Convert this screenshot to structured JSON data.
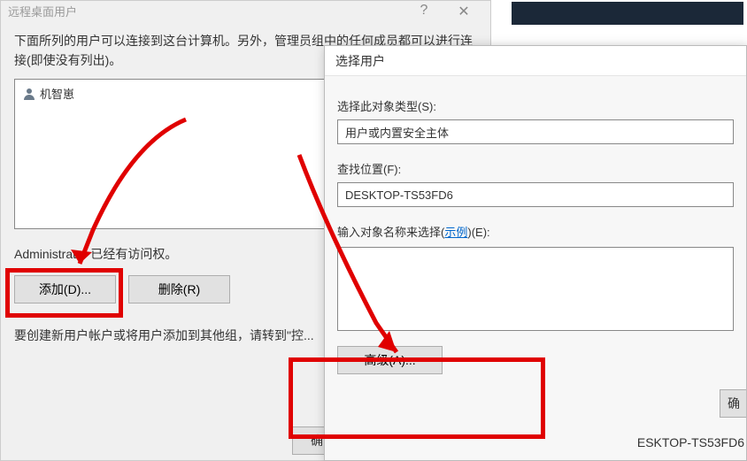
{
  "left_dialog": {
    "title": "远程桌面用户",
    "description": "下面所列的用户可以连接到这台计算机。另外，管理员组中的任何成员都可以进行连接(即使没有列出)。",
    "users": [
      {
        "name": "机智崽"
      }
    ],
    "admin_note": "Administrator 已经有访问权。",
    "add_button": "添加(D)...",
    "remove_button": "删除(R)",
    "create_note": "要创建新用户帐户或将用户添加到其他组，请转到\"控...",
    "ok_button": "确"
  },
  "right_dialog": {
    "title": "选择用户",
    "object_type_label": "选择此对象类型(S):",
    "object_type": "用户或内置安全主体",
    "location_label": "查找位置(F):",
    "location": "DESKTOP-TS53FD6",
    "names_label_prefix": "输入对象名称来选择(",
    "names_label_link": "示例",
    "names_label_suffix": ")(E):",
    "names_value": "",
    "advanced_button": "高级(A)...",
    "ok_right_text": "确",
    "hostname_tail": "ESKTOP-TS53FD6"
  },
  "colors": {
    "accent_red": "#e00000",
    "link": "#0066cc"
  }
}
